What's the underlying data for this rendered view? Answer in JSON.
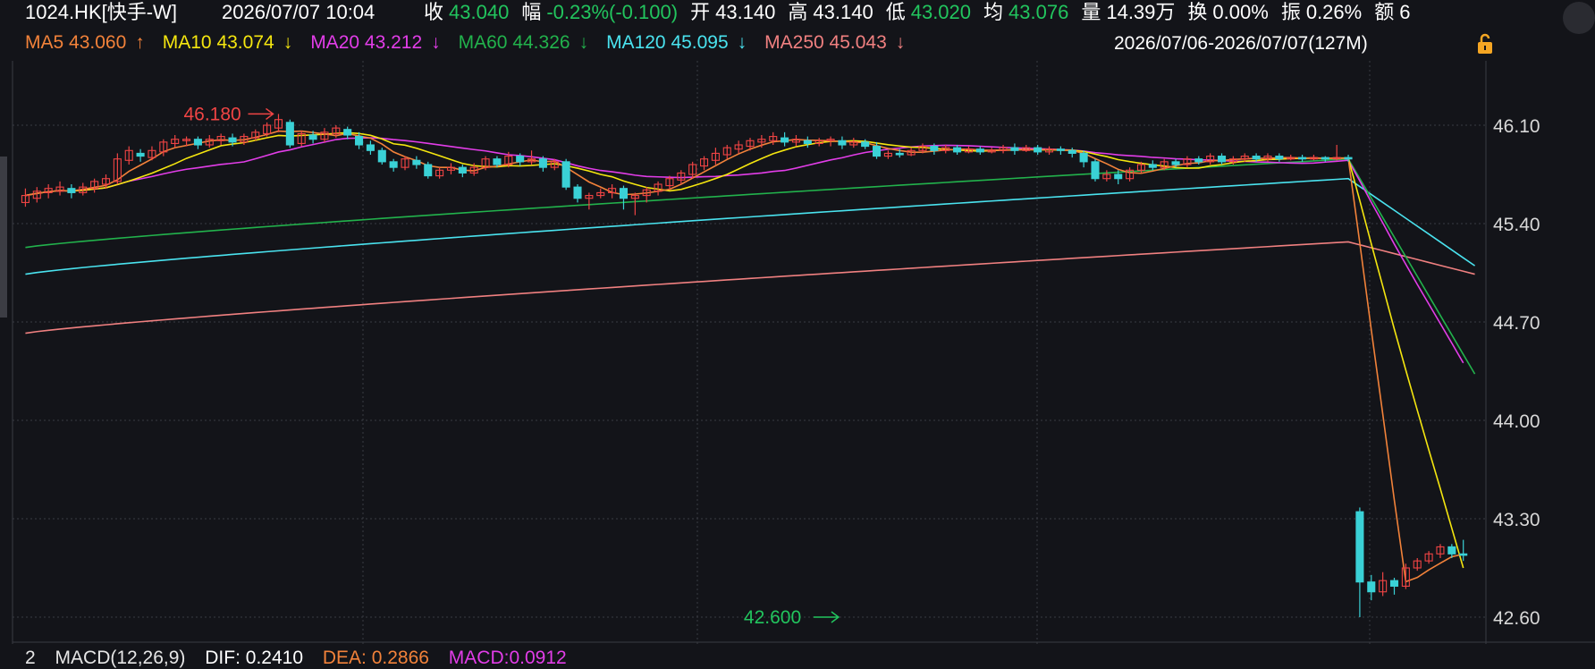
{
  "header": {
    "symbol": "1024.HK[快手-W]",
    "datetime": "2026/07/07 10:04",
    "stats": [
      {
        "label": "收",
        "value": "43.040",
        "color": "#22c55e"
      },
      {
        "label": "幅",
        "value": "-0.23%(-0.100)",
        "color": "#22c55e"
      },
      {
        "label": "开",
        "value": "43.140",
        "color": "#ffffff"
      },
      {
        "label": "高",
        "value": "43.140",
        "color": "#ffffff"
      },
      {
        "label": "低",
        "value": "43.020",
        "color": "#22c55e"
      },
      {
        "label": "均",
        "value": "43.076",
        "color": "#22c55e"
      },
      {
        "label": "量",
        "value": "14.39万",
        "color": "#ffffff"
      },
      {
        "label": "换",
        "value": "0.00%",
        "color": "#ffffff"
      },
      {
        "label": "振",
        "value": "0.26%",
        "color": "#ffffff"
      },
      {
        "label": "额",
        "value": "6",
        "color": "#ffffff"
      }
    ]
  },
  "ma_legend": [
    {
      "name": "MA5",
      "value": "43.060",
      "arrow": "↑",
      "color": "#f2823a"
    },
    {
      "name": "MA10",
      "value": "43.074",
      "arrow": "↓",
      "color": "#f5e60f"
    },
    {
      "name": "MA20",
      "value": "43.212",
      "arrow": "↓",
      "color": "#e23de8"
    },
    {
      "name": "MA60",
      "value": "44.326",
      "arrow": "↓",
      "color": "#22b24c"
    },
    {
      "name": "MA120",
      "value": "45.095",
      "arrow": "↓",
      "color": "#4ae3ef"
    },
    {
      "name": "MA250",
      "value": "45.043",
      "arrow": "↓",
      "color": "#f08080"
    }
  ],
  "date_range": "2026/07/06-2026/07/07(127M)",
  "macd": {
    "index": "2",
    "label": "MACD(12,26,9)",
    "dif": "DIF: 0.2410",
    "dea": "DEA: 0.2866",
    "macd": "MACD:0.0912",
    "colors": {
      "dif": "#ffffff",
      "dea": "#f2823a",
      "macd": "#e23de8"
    }
  },
  "annotations": {
    "high_label": "46.180",
    "low_label": "42.600"
  },
  "colors": {
    "background": "#131419",
    "up": "#ef4444",
    "down": "#3ad1d6",
    "grid": "#3a3b42"
  },
  "chart_data": {
    "type": "candlestick",
    "y_ticks": [
      "46.10",
      "45.40",
      "44.70",
      "44.00",
      "43.30",
      "42.60"
    ],
    "ylim": [
      42.55,
      46.25
    ],
    "n_bars": 127,
    "high_annotation": {
      "value": 46.18,
      "index": 22
    },
    "low_annotation": {
      "value": 42.6,
      "index": 71
    },
    "candles": [
      [
        45.55,
        45.6,
        45.52,
        45.65
      ],
      [
        45.58,
        45.63,
        45.55,
        45.66
      ],
      [
        45.62,
        45.65,
        45.58,
        45.68
      ],
      [
        45.63,
        45.66,
        45.6,
        45.7
      ],
      [
        45.65,
        45.62,
        45.58,
        45.68
      ],
      [
        45.62,
        45.66,
        45.6,
        45.69
      ],
      [
        45.65,
        45.7,
        45.62,
        45.72
      ],
      [
        45.68,
        45.72,
        45.65,
        45.75
      ],
      [
        45.7,
        45.86,
        45.68,
        45.9
      ],
      [
        45.85,
        45.92,
        45.82,
        45.95
      ],
      [
        45.9,
        45.88,
        45.84,
        45.93
      ],
      [
        45.87,
        45.92,
        45.85,
        45.95
      ],
      [
        45.91,
        45.98,
        45.88,
        46.0
      ],
      [
        45.97,
        46.0,
        45.94,
        46.03
      ],
      [
        45.99,
        46.0,
        45.95,
        46.02
      ],
      [
        46.0,
        45.96,
        45.93,
        46.02
      ],
      [
        45.96,
        46.0,
        45.94,
        46.03
      ],
      [
        45.99,
        46.02,
        45.96,
        46.04
      ],
      [
        46.01,
        45.98,
        45.95,
        46.04
      ],
      [
        45.98,
        46.02,
        45.96,
        46.04
      ],
      [
        46.01,
        46.05,
        45.99,
        46.07
      ],
      [
        46.04,
        46.1,
        46.02,
        46.12
      ],
      [
        46.08,
        46.14,
        46.05,
        46.18
      ],
      [
        46.12,
        45.96,
        45.94,
        46.14
      ],
      [
        45.97,
        46.04,
        45.95,
        46.06
      ],
      [
        46.03,
        46.0,
        45.97,
        46.06
      ],
      [
        46.0,
        46.05,
        45.98,
        46.08
      ],
      [
        46.04,
        46.08,
        46.01,
        46.1
      ],
      [
        46.07,
        46.03,
        46.0,
        46.09
      ],
      [
        46.02,
        45.96,
        45.93,
        46.05
      ],
      [
        45.96,
        45.92,
        45.89,
        45.99
      ],
      [
        45.92,
        45.84,
        45.82,
        45.94
      ],
      [
        45.84,
        45.8,
        45.77,
        45.86
      ],
      [
        45.8,
        45.86,
        45.78,
        45.88
      ],
      [
        45.85,
        45.82,
        45.79,
        45.88
      ],
      [
        45.82,
        45.74,
        45.72,
        45.84
      ],
      [
        45.74,
        45.78,
        45.72,
        45.8
      ],
      [
        45.78,
        45.8,
        45.75,
        45.83
      ],
      [
        45.8,
        45.76,
        45.73,
        45.82
      ],
      [
        45.76,
        45.8,
        45.74,
        45.83
      ],
      [
        45.8,
        45.86,
        45.78,
        45.88
      ],
      [
        45.86,
        45.82,
        45.8,
        45.88
      ],
      [
        45.82,
        45.88,
        45.8,
        45.91
      ],
      [
        45.88,
        45.84,
        45.81,
        45.9
      ],
      [
        45.84,
        45.86,
        45.82,
        45.92
      ],
      [
        45.86,
        45.8,
        45.77,
        45.88
      ],
      [
        45.8,
        45.84,
        45.78,
        45.86
      ],
      [
        45.84,
        45.66,
        45.64,
        45.86
      ],
      [
        45.66,
        45.58,
        45.55,
        45.68
      ],
      [
        45.58,
        45.6,
        45.5,
        45.62
      ],
      [
        45.6,
        45.62,
        45.58,
        45.65
      ],
      [
        45.62,
        45.65,
        45.58,
        45.68
      ],
      [
        45.65,
        45.58,
        45.5,
        45.67
      ],
      [
        45.58,
        45.6,
        45.46,
        45.62
      ],
      [
        45.6,
        45.64,
        45.55,
        45.66
      ],
      [
        45.63,
        45.68,
        45.6,
        45.7
      ],
      [
        45.67,
        45.72,
        45.64,
        45.74
      ],
      [
        45.71,
        45.76,
        45.68,
        45.78
      ],
      [
        45.75,
        45.82,
        45.72,
        45.84
      ],
      [
        45.81,
        45.86,
        45.78,
        45.88
      ],
      [
        45.85,
        45.9,
        45.82,
        45.94
      ],
      [
        45.89,
        45.94,
        45.86,
        45.96
      ],
      [
        45.93,
        45.96,
        45.9,
        45.99
      ],
      [
        45.95,
        45.99,
        45.92,
        46.01
      ],
      [
        45.98,
        46.0,
        45.94,
        46.03
      ],
      [
        45.99,
        46.02,
        45.96,
        46.05
      ],
      [
        46.01,
        45.98,
        45.95,
        46.05
      ],
      [
        45.98,
        46.0,
        45.95,
        46.03
      ],
      [
        45.99,
        45.97,
        45.94,
        46.02
      ],
      [
        45.97,
        45.99,
        45.95,
        46.01
      ],
      [
        45.99,
        46.0,
        45.95,
        46.02
      ],
      [
        45.99,
        45.96,
        45.93,
        46.02
      ],
      [
        45.96,
        45.98,
        45.94,
        46.01
      ],
      [
        45.98,
        45.95,
        45.93,
        46.0
      ],
      [
        45.95,
        45.88,
        45.86,
        45.98
      ],
      [
        45.88,
        45.9,
        45.86,
        45.92
      ],
      [
        45.9,
        45.89,
        45.87,
        45.93
      ],
      [
        45.89,
        45.92,
        45.88,
        45.94
      ],
      [
        45.92,
        45.95,
        45.9,
        45.97
      ],
      [
        45.95,
        45.92,
        45.89,
        45.97
      ],
      [
        45.92,
        45.94,
        45.9,
        45.96
      ],
      [
        45.94,
        45.91,
        45.89,
        45.96
      ],
      [
        45.91,
        45.93,
        45.9,
        45.95
      ],
      [
        45.93,
        45.91,
        45.89,
        45.95
      ],
      [
        45.91,
        45.92,
        45.9,
        45.94
      ],
      [
        45.92,
        45.94,
        45.9,
        45.96
      ],
      [
        45.94,
        45.92,
        45.89,
        45.97
      ],
      [
        45.92,
        45.94,
        45.91,
        45.96
      ],
      [
        45.94,
        45.91,
        45.89,
        45.96
      ],
      [
        45.91,
        45.93,
        45.89,
        45.95
      ],
      [
        45.93,
        45.92,
        45.89,
        45.95
      ],
      [
        45.92,
        45.9,
        45.87,
        45.94
      ],
      [
        45.9,
        45.84,
        45.8,
        45.92
      ],
      [
        45.84,
        45.72,
        45.7,
        45.86
      ],
      [
        45.72,
        45.75,
        45.7,
        45.78
      ],
      [
        45.75,
        45.72,
        45.68,
        45.78
      ],
      [
        45.72,
        45.78,
        45.7,
        45.8
      ],
      [
        45.78,
        45.82,
        45.76,
        45.84
      ],
      [
        45.82,
        45.8,
        45.78,
        45.85
      ],
      [
        45.8,
        45.84,
        45.78,
        45.86
      ],
      [
        45.84,
        45.82,
        45.8,
        45.86
      ],
      [
        45.82,
        45.86,
        45.8,
        45.88
      ],
      [
        45.86,
        45.84,
        45.82,
        45.88
      ],
      [
        45.84,
        45.88,
        45.82,
        45.9
      ],
      [
        45.88,
        45.84,
        45.82,
        45.9
      ],
      [
        45.84,
        45.86,
        45.82,
        45.88
      ],
      [
        45.86,
        45.88,
        45.84,
        45.9
      ],
      [
        45.88,
        45.86,
        45.84,
        45.9
      ],
      [
        45.86,
        45.88,
        45.84,
        45.9
      ],
      [
        45.88,
        45.86,
        45.84,
        45.9
      ],
      [
        45.86,
        45.87,
        45.85,
        45.89
      ],
      [
        45.87,
        45.86,
        45.84,
        45.89
      ],
      [
        45.86,
        45.87,
        45.85,
        45.89
      ],
      [
        45.87,
        45.86,
        45.84,
        45.88
      ],
      [
        45.86,
        45.87,
        45.85,
        45.96
      ],
      [
        45.87,
        45.86,
        45.84,
        45.89
      ],
      [
        43.35,
        42.85,
        42.6,
        43.38
      ],
      [
        42.85,
        42.78,
        42.72,
        42.9
      ],
      [
        42.78,
        42.86,
        42.75,
        42.92
      ],
      [
        42.86,
        42.82,
        42.76,
        42.88
      ],
      [
        42.82,
        42.95,
        42.8,
        42.98
      ],
      [
        42.95,
        43.0,
        42.93,
        43.02
      ],
      [
        43.0,
        43.05,
        42.98,
        43.07
      ],
      [
        43.05,
        43.1,
        43.02,
        43.12
      ],
      [
        43.1,
        43.05,
        43.02,
        43.12
      ],
      [
        43.05,
        43.04,
        43.0,
        43.15
      ]
    ]
  }
}
